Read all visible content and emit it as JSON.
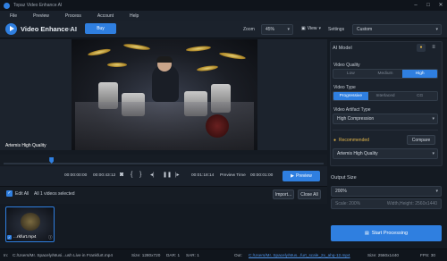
{
  "app": {
    "window_title": "Topaz Video Enhance AI",
    "name": "Video Enhance AI",
    "version": "v2.6.2",
    "buy_label": "Buy"
  },
  "menu": [
    "File",
    "Preview",
    "Process",
    "Account",
    "Help"
  ],
  "toolbar": {
    "zoom_label": "Zoom",
    "zoom_value": "45%",
    "view_label": "View",
    "settings_label": "Settings",
    "settings_value": "Custom"
  },
  "preview": {
    "overlay_label": "Artemis High Quality",
    "time_start": "00:00:00:00",
    "time_end": "00:00:43:12",
    "time_current": "00:01:18:14",
    "preview_time_label": "Preview Time",
    "preview_time_value": "00:00:01:00",
    "preview_button": "Preview",
    "scrub_position": 0.15
  },
  "file_list": {
    "edit_all_label": "Edit All",
    "selected_text": "All 1 videos selected",
    "import_button": "Import...",
    "close_all_button": "Close All",
    "items": [
      {
        "name": "...rkfurt.mp4"
      }
    ]
  },
  "ai_model": {
    "header": "AI Model",
    "video_quality_label": "Video Quality",
    "quality_options": [
      "Low",
      "Medium",
      "High"
    ],
    "quality_selected": "High",
    "video_type_label": "Video Type",
    "type_options": [
      "Progressive",
      "Interlaced",
      "CG"
    ],
    "type_selected": "Progressive",
    "artifact_label": "Video Artifact Type",
    "artifact_value": "High Compression",
    "recommended_label": "Recommended",
    "compare_button": "Compare",
    "model_value": "Artemis High Quality"
  },
  "output_size": {
    "header": "Output Size",
    "value": "200%",
    "scale_text": "Scale: 200%",
    "dims_text": "Width,Height: 2560x1440"
  },
  "start_button": "Start Processing",
  "status": {
    "in_label": "In:",
    "in_path": "C:/Users/Mr. Spacely/Musi...ush Live in Frankfurt.mp4",
    "size_in": "Size: 1280x720",
    "dar": "DAR: 1",
    "sar": "SAR: 1",
    "out_label": "Out:",
    "out_path": "C:/Users/Mr. Spacely/Mus...furt_scale_2x_ahq-12.mp4",
    "size_out": "Size: 2560x1440",
    "fps": "FPS: 30"
  },
  "colors": {
    "accent": "#2f7fe0",
    "background": "#141a22",
    "panel": "#1b222c"
  }
}
